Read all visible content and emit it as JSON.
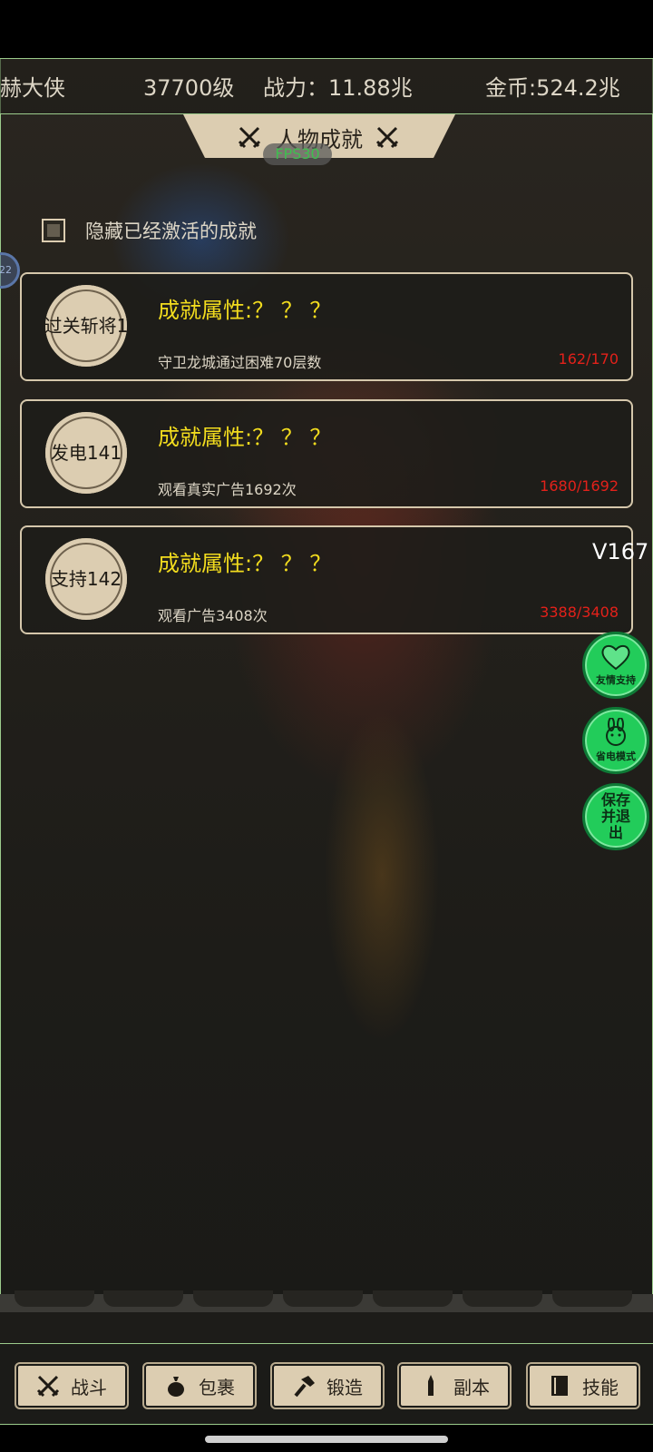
{
  "header": {
    "player_name": "赫大侠",
    "level": "37700级",
    "power": "战力：11.88兆",
    "gold": "金币:524.2兆"
  },
  "panel": {
    "title": "人物成就",
    "fps": "FPS30",
    "hide_activated_label": "隐藏已经激活的成就",
    "side_bubble_text": "22"
  },
  "achievements": [
    {
      "badge": "过关斩将1",
      "attr": "成就属性:？ ？ ？",
      "desc": "守卫龙城通过困难70层数",
      "progress": "162/170"
    },
    {
      "badge": "发电141",
      "attr": "成就属性:？ ？ ？",
      "desc": "观看真实广告1692次",
      "progress": "1680/1692"
    },
    {
      "badge": "支持142",
      "attr": "成就属性:？ ？ ？",
      "desc": "观看广告3408次",
      "progress": "3388/3408"
    }
  ],
  "version": "V167",
  "side_buttons": {
    "support": {
      "label": "友情支持",
      "icon": "heart-icon"
    },
    "power_save": {
      "label": "省电模式",
      "icon": "rabbit-icon"
    },
    "save_exit": {
      "label": "保存并退出"
    }
  },
  "bottom_nav": [
    {
      "label": "战斗",
      "icon": "crossed-swords-icon"
    },
    {
      "label": "包裹",
      "icon": "bag-icon"
    },
    {
      "label": "锻造",
      "icon": "hammer-icon"
    },
    {
      "label": "副本",
      "icon": "tower-icon"
    },
    {
      "label": "技能",
      "icon": "book-icon"
    }
  ],
  "colors": {
    "accent_yellow": "#f2dc1e",
    "progress_red": "#e3211a",
    "parchment": "#dccdb1",
    "fab_green": "#22cc5a",
    "border_green": "#9ccc8c"
  }
}
